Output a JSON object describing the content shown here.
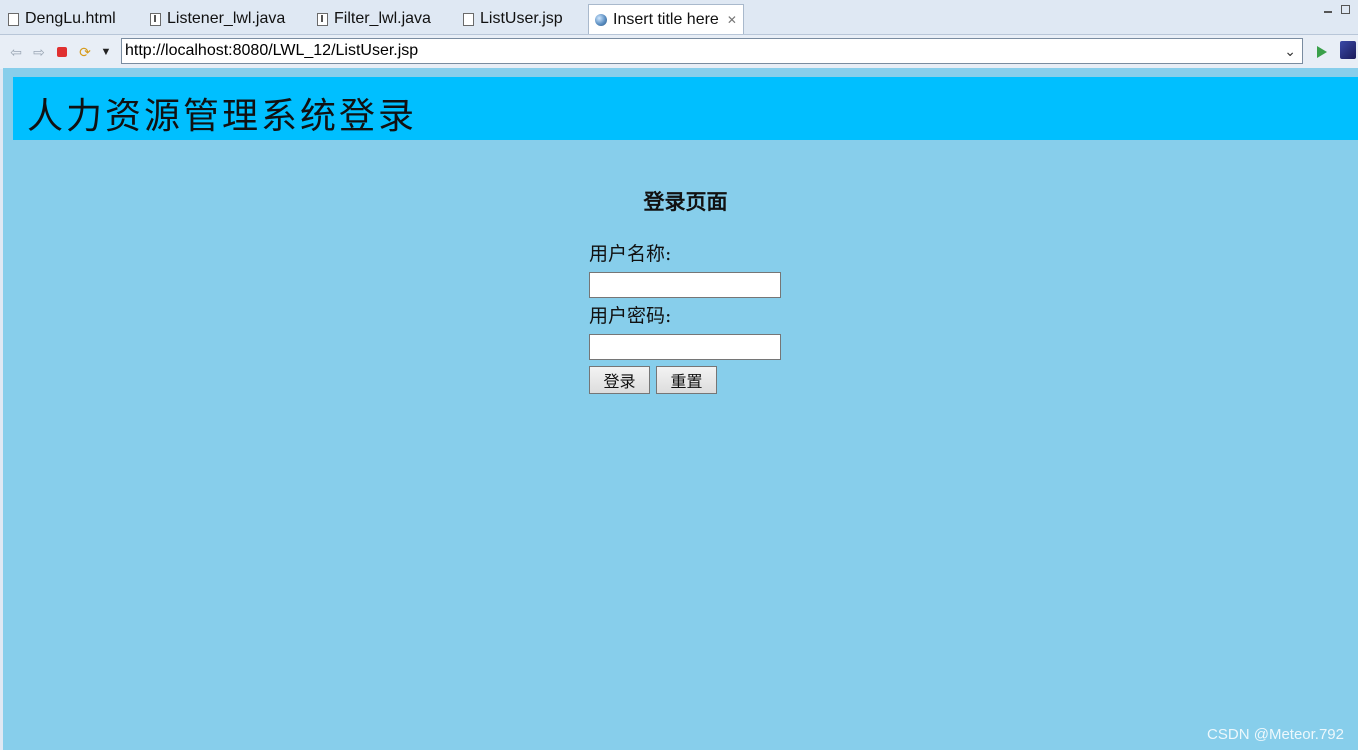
{
  "tabs": [
    {
      "label": "DengLu.html",
      "icon": "html-file-icon"
    },
    {
      "label": "Listener_lwl.java",
      "icon": "java-file-icon"
    },
    {
      "label": "Filter_lwl.java",
      "icon": "java-file-icon"
    },
    {
      "label": "ListUser.jsp",
      "icon": "jsp-file-icon"
    },
    {
      "label": "Insert title here",
      "icon": "globe-icon",
      "active": true
    }
  ],
  "toolbar": {
    "url": "http://localhost:8080/LWL_12/ListUser.jsp"
  },
  "page": {
    "header_title": "人力资源管理系统登录",
    "login_title": "登录页面",
    "username_label": "用户名称:",
    "password_label": "用户密码:",
    "username_value": "",
    "password_value": "",
    "login_button": "登录",
    "reset_button": "重置"
  },
  "watermark": "CSDN @Meteor.792",
  "colors": {
    "page_background": "#87ceeb",
    "header_background": "#00bfff",
    "ide_background": "#dfe8f3"
  }
}
